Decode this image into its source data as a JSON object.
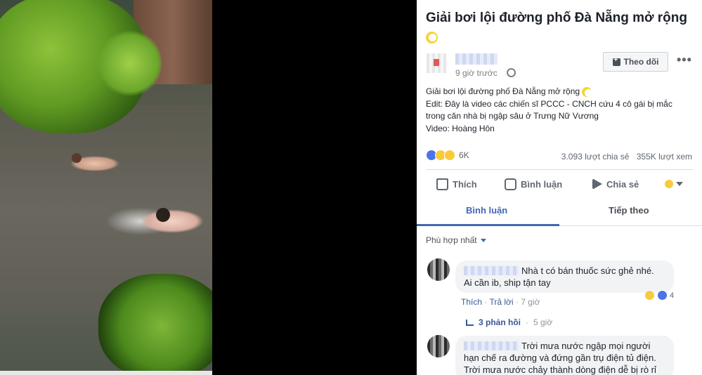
{
  "post": {
    "title": "Giải bơi lội đường phố Đà Nẵng mở rộng",
    "time": "9 giờ trước",
    "follow_label": "Theo dõi",
    "lines": [
      "Giải bơi lội đường phố Đà Nẵng mở rộng",
      "Edit: Đây là video các chiến sĩ PCCC - CNCH cứu 4 cô gái bị mắc",
      "trong căn nhà bị ngập sâu ở Trưng Nữ Vương",
      "Video: Hoàng Hôn"
    ],
    "reaction_count": "6K",
    "shares": "3.093 lượt chia sẻ",
    "views": "355K lượt xem"
  },
  "actions": {
    "like": "Thích",
    "comment": "Bình luận",
    "share": "Chia sẻ"
  },
  "tabs": {
    "comments": "Bình luận",
    "up_next": "Tiếp theo"
  },
  "colors": {
    "link": "#385898",
    "active_tab": "#4267b2"
  },
  "sort_label": "Phù hợp nhất",
  "comments": [
    {
      "text_line1": "Nhà t có bán thuốc sức ghẻ nhé.",
      "text_line2": "Ai cần ib, ship tận tay",
      "reaction_count": "4",
      "like": "Thích",
      "reply": "Trả lời",
      "time": "7 giờ",
      "replies": "3 phản hồi",
      "replies_time": "5 giờ"
    },
    {
      "text_line1": "Trời mưa nước ngập mọi người",
      "text_line2": "hạn chế ra đường và đứng gần trụ điện tủ điện.",
      "text_line3": "Trời mưa nước chảy thành dòng điện dễ bị rò rỉ"
    }
  ]
}
